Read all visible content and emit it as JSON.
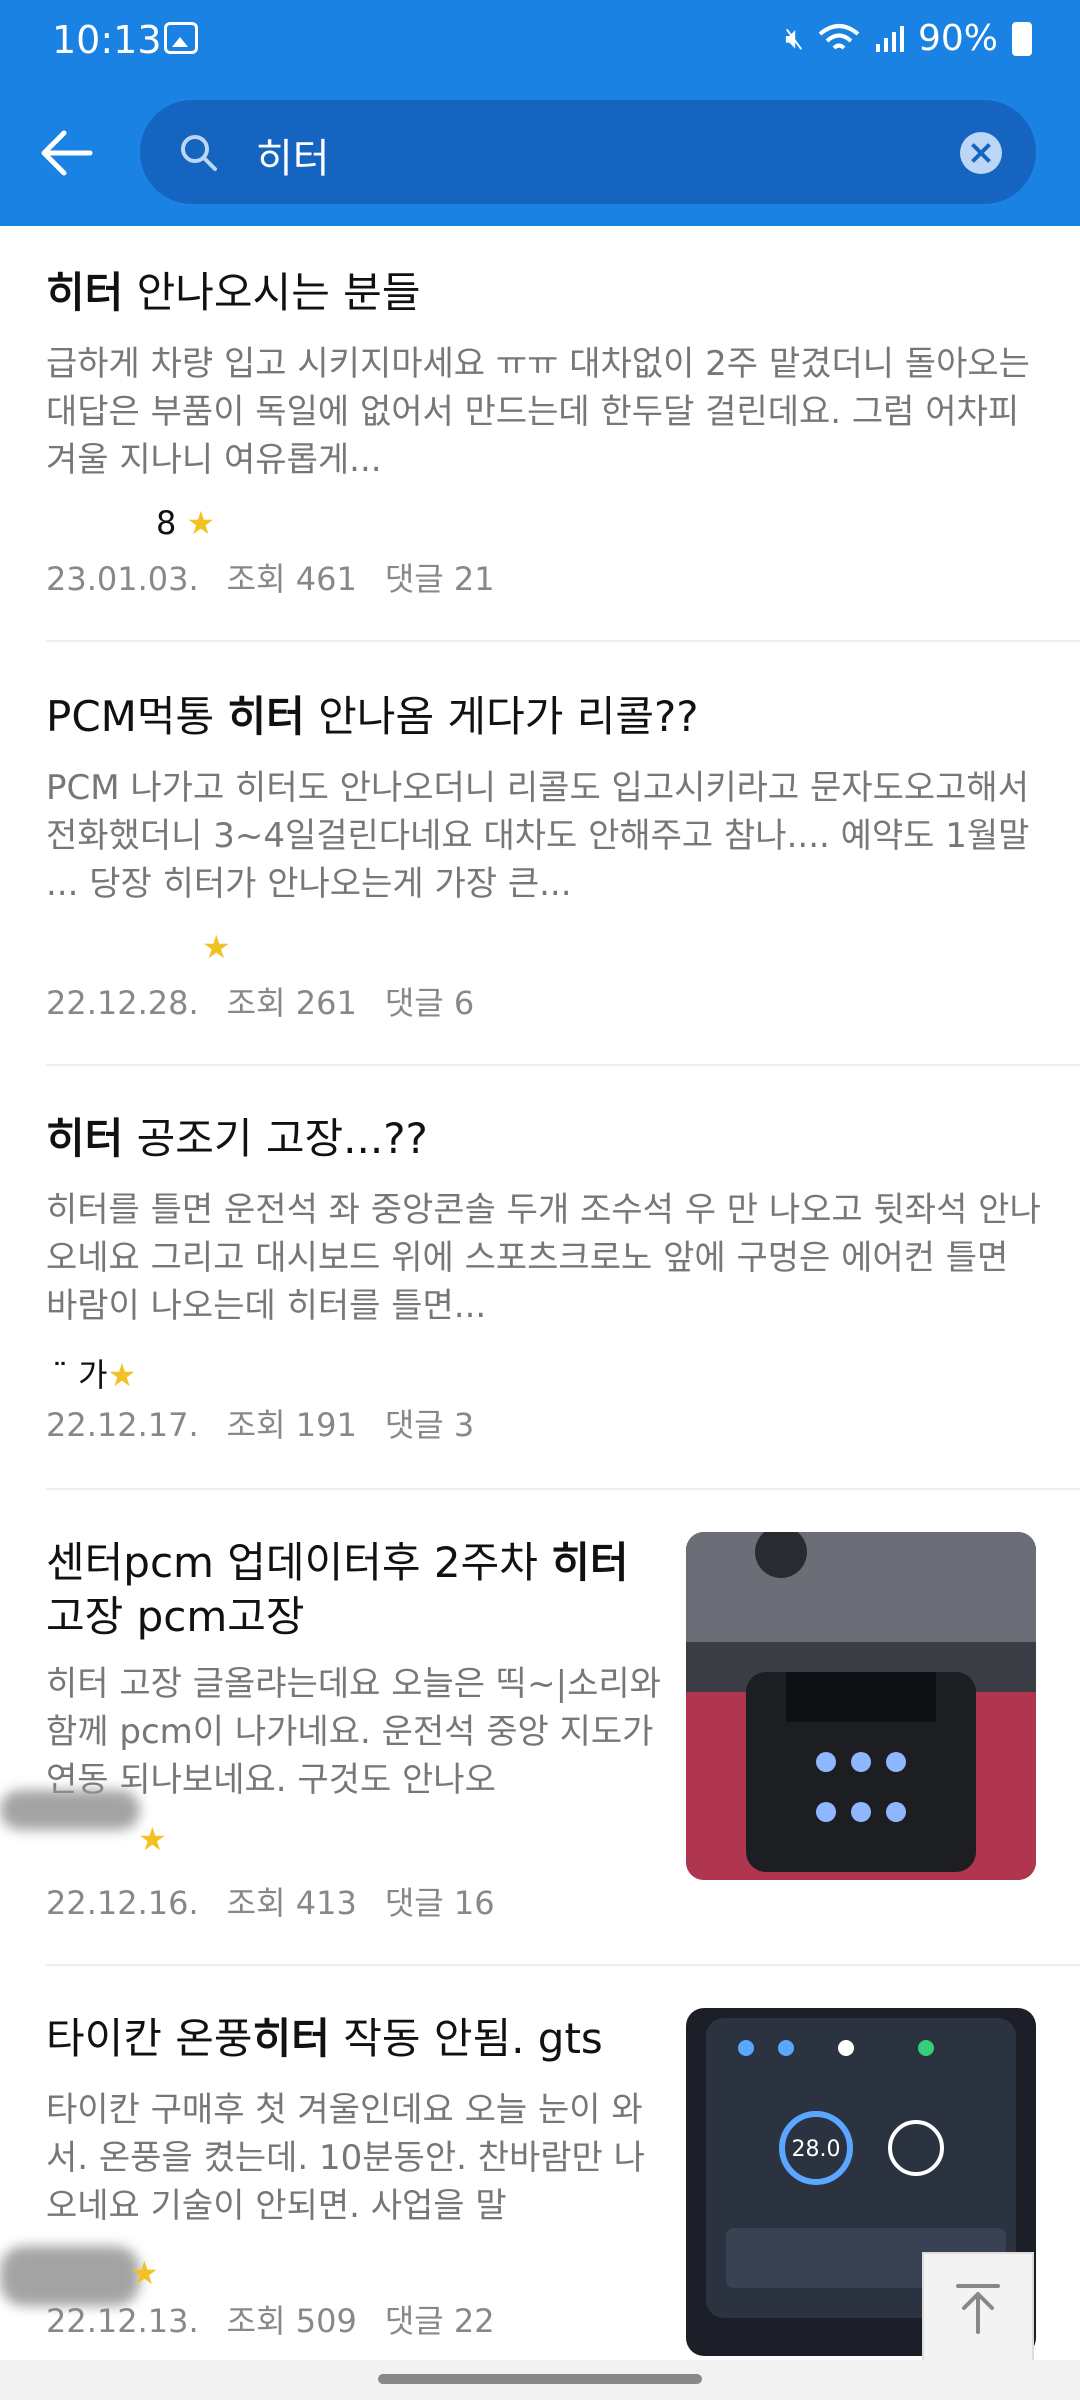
{
  "status": {
    "time": "10:13",
    "battery": "90%"
  },
  "search": {
    "query": "히터"
  },
  "results": [
    {
      "title_pre": "",
      "title_bold": "히터",
      "title_post": " 안나오시는 분들",
      "snippet": "급하게 차량 입고 시키지마세요 ㅠㅠ 대차없이 2주 맡겼더니 돌아오는 대답은 부품이 독일에 없어서 만드는데 한두달 걸린데요. 그럼 어차피 겨울 지나니 여유롭게...",
      "author": "8",
      "date": "23.01.03.",
      "views": "조회 461",
      "comments": "댓글 21"
    },
    {
      "title_pre": "PCM먹통 ",
      "title_bold": "히터",
      "title_post": " 안나옴 게다가 리콜??",
      "snippet": "PCM 나가고 히터도 안나오더니 리콜도 입고시키라고 문자도오고해서 전화했더니 3~4일걸린다네요 대차도 안해주고 참나.... 예약도 1월말 ... 당장 히터가 안나오는게 가장 큰...",
      "author": "",
      "date": "22.12.28.",
      "views": "조회 261",
      "comments": "댓글 6"
    },
    {
      "title_pre": "",
      "title_bold": "히터",
      "title_post": " 공조기 고장...??",
      "snippet": "히터를 틀면 운전석 좌 중앙콘솔 두개 조수석 우 만 나오고 뒷좌석 안나오네요 그리고 대시보드 위에 스포츠크로노 앞에 구멍은 에어컨 틀면 바람이 나오는데 히터를 틀면...",
      "author": "¨  가",
      "date": "22.12.17.",
      "views": "조회 191",
      "comments": "댓글 3"
    },
    {
      "title_pre": "센터pcm 업데이터후 2주차 ",
      "title_bold": "히터",
      "title_post": "",
      "title_line2": "고장 pcm고장",
      "snippet": "히터 고장 글올랴는데요 오늘은 띡~|소리와함께 pcm이 나가네요. 운전석 중앙 지도가 연동 되나보네요. 구것도 안나오",
      "author": "",
      "date": "22.12.16.",
      "views": "조회 413",
      "comments": "댓글 16"
    },
    {
      "title_pre": "타이칸 온풍",
      "title_bold": "히터",
      "title_post": " 작동 안됨. gts",
      "snippet": "타이칸 구매후 첫 겨울인데요 오늘 눈이 와서. 온풍을 켰는데. 10분동안. 찬바람만 나오네요 기술이 안되면. 사업을 말",
      "author": "",
      "date": "22.12.13.",
      "views": "조회 509",
      "comments": "댓글 22",
      "thumb_readout": "28.0"
    }
  ],
  "icons": {
    "back": "arrow-left-icon",
    "search": "search-icon",
    "clear": "clear-icon",
    "scroll_top": "arrow-up-icon"
  },
  "colors": {
    "accent": "#1a82e2",
    "star": "#f2c225"
  }
}
